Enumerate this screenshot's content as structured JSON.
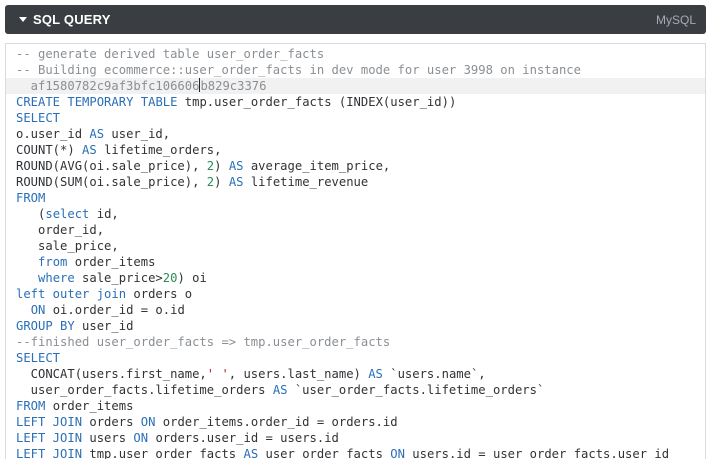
{
  "header": {
    "title": "SQL QUERY",
    "dialect": "MySQL"
  },
  "colors": {
    "keyword": "#2a6fb8",
    "comment": "#8a8f95",
    "number": "#2e8b57",
    "string": "#b22222",
    "text": "#303337",
    "header_bg": "#3a3d42"
  },
  "icons": {
    "collapse": "caret-down-icon"
  },
  "editor": {
    "lines": [
      [
        {
          "t": "-- generate derived table user_order_facts",
          "c": "cm"
        }
      ],
      [
        {
          "t": "-- Building ecommerce::user_order_facts in dev mode for user 3998 on instance",
          "c": "cm"
        }
      ],
      [
        {
          "t": "  af1580782c9af3bfc106606",
          "c": "cm"
        },
        {
          "t": "",
          "c": "cursor"
        },
        {
          "t": "b829c3376",
          "c": "cm"
        }
      ],
      [
        {
          "t": "CREATE",
          "c": "kw"
        },
        {
          "t": " "
        },
        {
          "t": "TEMPORARY",
          "c": "kw"
        },
        {
          "t": " "
        },
        {
          "t": "TABLE",
          "c": "kw"
        },
        {
          "t": " tmp.user_order_facts (INDEX(user_id))"
        }
      ],
      [
        {
          "t": "SELECT",
          "c": "kw"
        }
      ],
      [
        {
          "t": "o.user_id "
        },
        {
          "t": "AS",
          "c": "kw"
        },
        {
          "t": " user_id,"
        }
      ],
      [
        {
          "t": "COUNT(*) "
        },
        {
          "t": "AS",
          "c": "kw"
        },
        {
          "t": " lifetime_orders,"
        }
      ],
      [
        {
          "t": "ROUND(AVG(oi.sale_price), "
        },
        {
          "t": "2",
          "c": "num"
        },
        {
          "t": ") "
        },
        {
          "t": "AS",
          "c": "kw"
        },
        {
          "t": " average_item_price,"
        }
      ],
      [
        {
          "t": "ROUND(SUM(oi.sale_price), "
        },
        {
          "t": "2",
          "c": "num"
        },
        {
          "t": ") "
        },
        {
          "t": "AS",
          "c": "kw"
        },
        {
          "t": " lifetime_revenue"
        }
      ],
      [
        {
          "t": "FROM",
          "c": "kw"
        }
      ],
      [
        {
          "t": "   ("
        },
        {
          "t": "select",
          "c": "kw"
        },
        {
          "t": " id,"
        }
      ],
      [
        {
          "t": "   order_id,"
        }
      ],
      [
        {
          "t": "   sale_price,"
        }
      ],
      [
        {
          "t": "   "
        },
        {
          "t": "from",
          "c": "kw"
        },
        {
          "t": " order_items"
        }
      ],
      [
        {
          "t": "   "
        },
        {
          "t": "where",
          "c": "kw"
        },
        {
          "t": " sale_price>"
        },
        {
          "t": "20",
          "c": "num"
        },
        {
          "t": ") oi"
        }
      ],
      [
        {
          "t": "left outer join",
          "c": "kw"
        },
        {
          "t": " orders o"
        }
      ],
      [
        {
          "t": "  "
        },
        {
          "t": "ON",
          "c": "kw"
        },
        {
          "t": " oi.order_id = o.id"
        }
      ],
      [
        {
          "t": "GROUP BY",
          "c": "kw"
        },
        {
          "t": " user_id"
        }
      ],
      [
        {
          "t": "--finished user_order_facts => tmp.user_order_facts",
          "c": "cm"
        }
      ],
      [
        {
          "t": "SELECT",
          "c": "kw"
        }
      ],
      [
        {
          "t": "  CONCAT(users.first_name,"
        },
        {
          "t": "' '",
          "c": "str"
        },
        {
          "t": ", users.last_name) "
        },
        {
          "t": "AS",
          "c": "kw"
        },
        {
          "t": " `users.name`,"
        }
      ],
      [
        {
          "t": "  user_order_facts.lifetime_orders "
        },
        {
          "t": "AS",
          "c": "kw"
        },
        {
          "t": " `user_order_facts.lifetime_orders`"
        }
      ],
      [
        {
          "t": "FROM",
          "c": "kw"
        },
        {
          "t": " order_items"
        }
      ],
      [
        {
          "t": "LEFT JOIN",
          "c": "kw"
        },
        {
          "t": " orders "
        },
        {
          "t": "ON",
          "c": "kw"
        },
        {
          "t": " order_items.order_id = orders.id"
        }
      ],
      [
        {
          "t": "LEFT JOIN",
          "c": "kw"
        },
        {
          "t": " users "
        },
        {
          "t": "ON",
          "c": "kw"
        },
        {
          "t": " orders.user_id = users.id"
        }
      ],
      [
        {
          "t": "LEFT JOIN",
          "c": "kw"
        },
        {
          "t": " tmp.user_order_facts "
        },
        {
          "t": "AS",
          "c": "kw"
        },
        {
          "t": " user_order_facts "
        },
        {
          "t": "ON",
          "c": "kw"
        },
        {
          "t": " users.id = user_order_facts.user_id"
        }
      ]
    ]
  }
}
